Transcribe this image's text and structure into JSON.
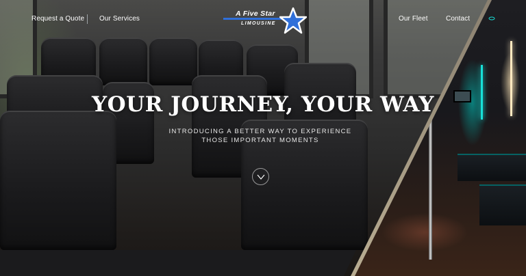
{
  "nav": {
    "left": [
      {
        "label": "Request a Quote"
      },
      {
        "label": "Our Services"
      }
    ],
    "right": [
      {
        "label": "Our Fleet"
      },
      {
        "label": "Contact"
      }
    ]
  },
  "logo": {
    "line1": "A Five Star",
    "line2": "LIMOUSINE",
    "star_color": "#2f6fd9"
  },
  "hero": {
    "headline": "YOUR JOURNEY, YOUR WAY",
    "subline_1": "INTRODUCING A BETTER WAY TO EXPERIENCE",
    "subline_2": "THOSE IMPORTANT MOMENTS",
    "scroll_icon": "chevron-down-icon"
  },
  "colors": {
    "accent_neon": "#18e0d8",
    "brand_blue": "#2f6fd9",
    "divider_gold": "#b9ad92"
  }
}
